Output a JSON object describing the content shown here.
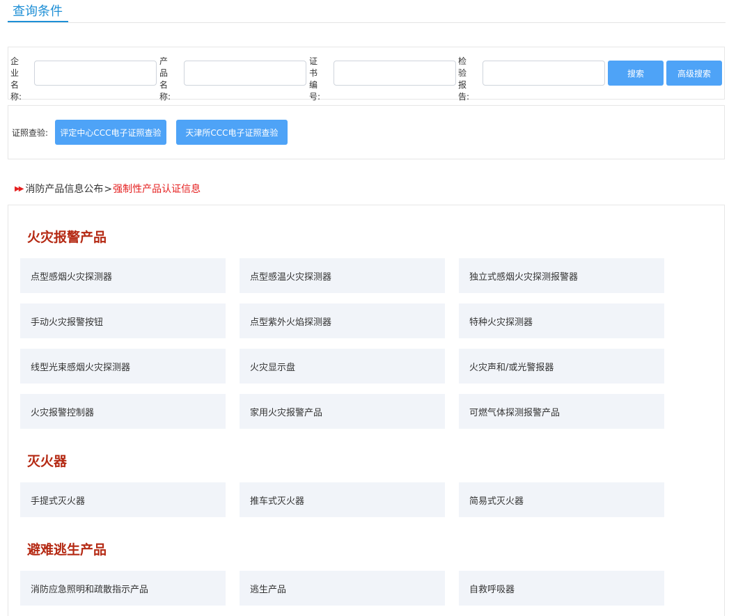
{
  "header": {
    "title": "查询条件"
  },
  "search": {
    "company_label": "企业名称:",
    "product_label": "产品名称:",
    "cert_label": "证书编号:",
    "report_label": "检验报告:",
    "company_value": "",
    "product_value": "",
    "cert_value": "",
    "report_value": "",
    "search_button": "搜索",
    "advanced_button": "高级搜索"
  },
  "verify": {
    "label": "证照查验:",
    "btn1": "评定中心CCC电子证照查验",
    "btn2": "天津所CCC电子证照查验"
  },
  "breadcrumb": {
    "arrows": "▶▶",
    "base": "消防产品信息公布",
    "sep": ">",
    "current": "强制性产品认证信息"
  },
  "categories": [
    {
      "title": "火灾报警产品",
      "items": [
        "点型感烟火灾探测器",
        "点型感温火灾探测器",
        "独立式感烟火灾探测报警器",
        "手动火灾报警按钮",
        "点型紫外火焰探测器",
        "特种火灾探测器",
        "线型光束感烟火灾探测器",
        "火灾显示盘",
        "火灾声和/或光警报器",
        "火灾报警控制器",
        "家用火灾报警产品",
        "可燃气体探测报警产品"
      ]
    },
    {
      "title": "灭火器",
      "items": [
        "手提式灭火器",
        "推车式灭火器",
        "简易式灭火器"
      ]
    },
    {
      "title": "避难逃生产品",
      "items": [
        "消防应急照明和疏散指示产品",
        "逃生产品",
        "自救呼吸器"
      ]
    }
  ]
}
